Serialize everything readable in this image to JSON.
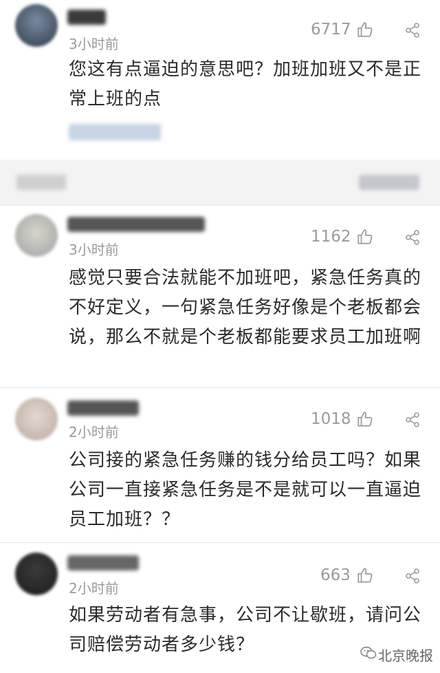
{
  "comments": [
    {
      "time": "3小时前",
      "likes": "6717",
      "text": "您这有点逼迫的意思吧？加班加班又不是正常上班的点"
    },
    {
      "time": "3小时前",
      "likes": "1162",
      "text": "感觉只要合法就能不加班吧，紧急任务真的不好定义，一句紧急任务好像是个老板都会说，那么不就是个老板都能要求员工加班啊"
    },
    {
      "time": "2小时前",
      "likes": "1018",
      "text": "公司接的紧急任务赚的钱分给员工吗？如果公司一直接紧急任务是不是就可以一直逼迫员工加班？？"
    },
    {
      "time": "2小时前",
      "likes": "663",
      "text": "如果劳动者有急事，公司不让歇班，请问公司赔偿劳动者多少钱？"
    }
  ],
  "watermark": {
    "source": "北京晚报"
  },
  "icons": {
    "like": "thumbs-up-icon",
    "share": "share-icon",
    "logo": "wechat-logo-icon"
  }
}
